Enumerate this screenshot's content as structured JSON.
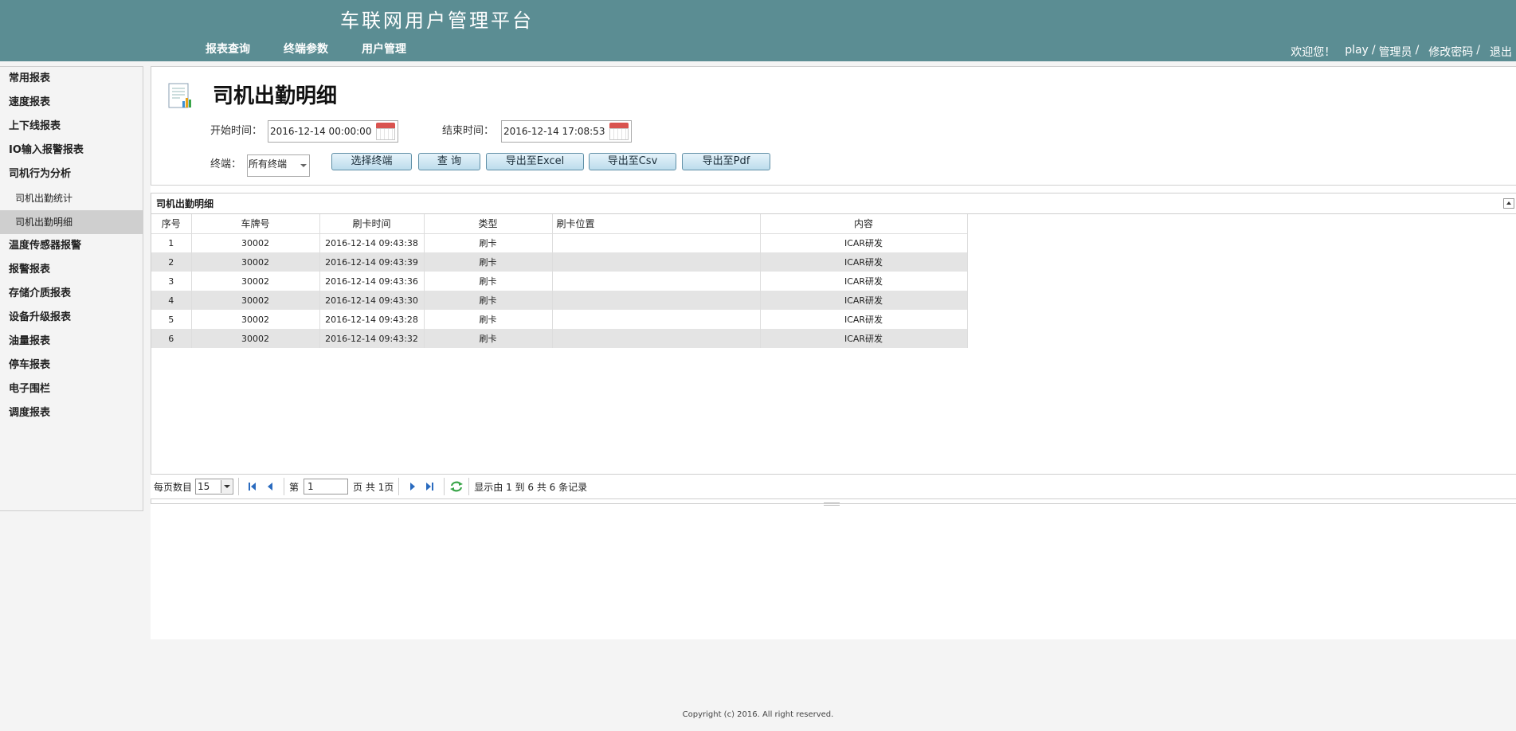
{
  "header": {
    "title": "车联网用户管理平台",
    "nav": [
      "报表查询",
      "终端参数",
      "用户管理"
    ],
    "user_bar": {
      "welcome": "欢迎您！",
      "username": "play",
      "sep": "/",
      "role": "管理员",
      "change_password": "修改密码",
      "logout": "退出"
    }
  },
  "sidebar": {
    "items": [
      {
        "label": "常用报表"
      },
      {
        "label": "速度报表"
      },
      {
        "label": "上下线报表"
      },
      {
        "label": "IO输入报警报表"
      },
      {
        "label": "司机行为分析"
      },
      {
        "label": "司机出勤统计"
      },
      {
        "label": "司机出勤明细"
      },
      {
        "label": "温度传感器报警"
      },
      {
        "label": "报警报表"
      },
      {
        "label": "存储介质报表"
      },
      {
        "label": "设备升级报表"
      },
      {
        "label": "油量报表"
      },
      {
        "label": "停车报表"
      },
      {
        "label": "电子围栏"
      },
      {
        "label": "调度报表"
      }
    ]
  },
  "page": {
    "title": "司机出勤明细",
    "start_label": "开始时间：",
    "start_value": "2016-12-14 00:00:00",
    "end_label": "结束时间：",
    "end_value": "2016-12-14 17:08:53",
    "terminal_label": "终端：",
    "terminal_value": "所有终端",
    "buttons": {
      "select_terminal": "选择终端",
      "query": "查 询",
      "export_excel": "导出至Excel",
      "export_csv": "导出至Csv",
      "export_pdf": "导出至Pdf"
    }
  },
  "grid": {
    "title": "司机出勤明细",
    "columns": [
      "序号",
      "车牌号",
      "刷卡时间",
      "类型",
      "刷卡位置",
      "内容"
    ],
    "rows": [
      [
        "1",
        "30002",
        "2016-12-14 09:43:38",
        "刷卡",
        "",
        "ICAR研发"
      ],
      [
        "2",
        "30002",
        "2016-12-14 09:43:39",
        "刷卡",
        "",
        "ICAR研发"
      ],
      [
        "3",
        "30002",
        "2016-12-14 09:43:36",
        "刷卡",
        "",
        "ICAR研发"
      ],
      [
        "4",
        "30002",
        "2016-12-14 09:43:30",
        "刷卡",
        "",
        "ICAR研发"
      ],
      [
        "5",
        "30002",
        "2016-12-14 09:43:28",
        "刷卡",
        "",
        "ICAR研发"
      ],
      [
        "6",
        "30002",
        "2016-12-14 09:43:32",
        "刷卡",
        "",
        "ICAR研发"
      ]
    ]
  },
  "pager": {
    "page_size_label": "每页数目",
    "page_size": "15",
    "page_prefix": "第",
    "page_number": "1",
    "page_suffix": "页 共 1页",
    "summary": "显示由 1 到 6 共 6 条记录"
  },
  "footer": "Copyright (c) 2016. All right reserved."
}
